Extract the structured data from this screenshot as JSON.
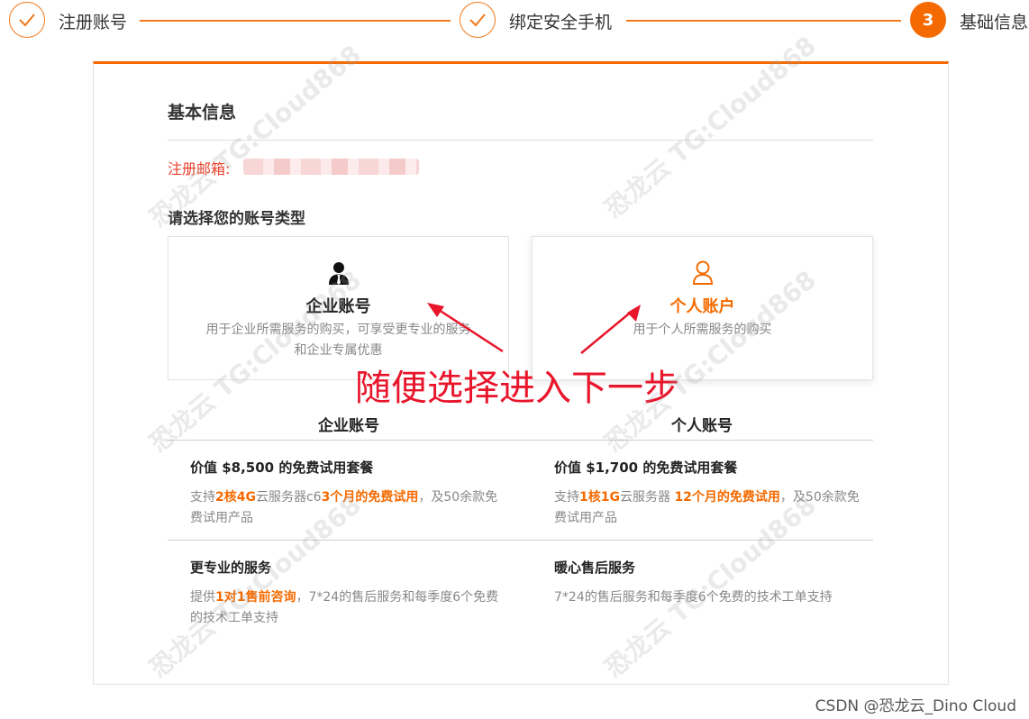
{
  "steps": [
    {
      "label": "注册账号",
      "state": "done"
    },
    {
      "label": "绑定安全手机",
      "state": "done"
    },
    {
      "label": "基础信息",
      "state": "active",
      "number": "3"
    }
  ],
  "accent_color": "#f56a00",
  "form": {
    "section_title": "基本信息",
    "email_label": "注册邮箱:",
    "account_type_label": "请选择您的账号类型",
    "options": [
      {
        "title": "企业账号",
        "desc_line1": "用于企业所需服务的购买，可享受更专业的服务",
        "desc_line2": "和企业专属优惠",
        "icon": "enterprise-user-icon",
        "selected": false
      },
      {
        "title": "个人账户",
        "desc_line1": "用于个人所需服务的购买",
        "icon": "person-icon",
        "selected": true
      }
    ]
  },
  "annotation": "随便选择进入下一步",
  "comparison": {
    "columns": [
      "企业账号",
      "个人账号"
    ],
    "enterprise": {
      "trial_title": "价值 $8,500 的免费试用套餐",
      "trial_desc": [
        "支持",
        "2核4G",
        "云服务器c6",
        "3个月的免费试用",
        "，及50余款免费试用产品"
      ],
      "service_title": "更专业的服务",
      "service_desc": [
        "提供",
        "1对1售前咨询",
        "，7*24的售后服务和每季度6个免费的技术工单支持"
      ]
    },
    "personal": {
      "trial_title": "价值 $1,700 的免费试用套餐",
      "trial_desc": [
        "支持",
        "1核1G",
        "云服务器 ",
        "12个月的免费试用",
        "，及50余款免费试用产品"
      ],
      "service_title": "暖心售后服务",
      "service_desc": "7*24的售后服务和每季度6个免费的技术工单支持"
    }
  },
  "watermark": "恐龙云 TG:Cloud868",
  "credit": "CSDN @恐龙云_Dino Cloud"
}
